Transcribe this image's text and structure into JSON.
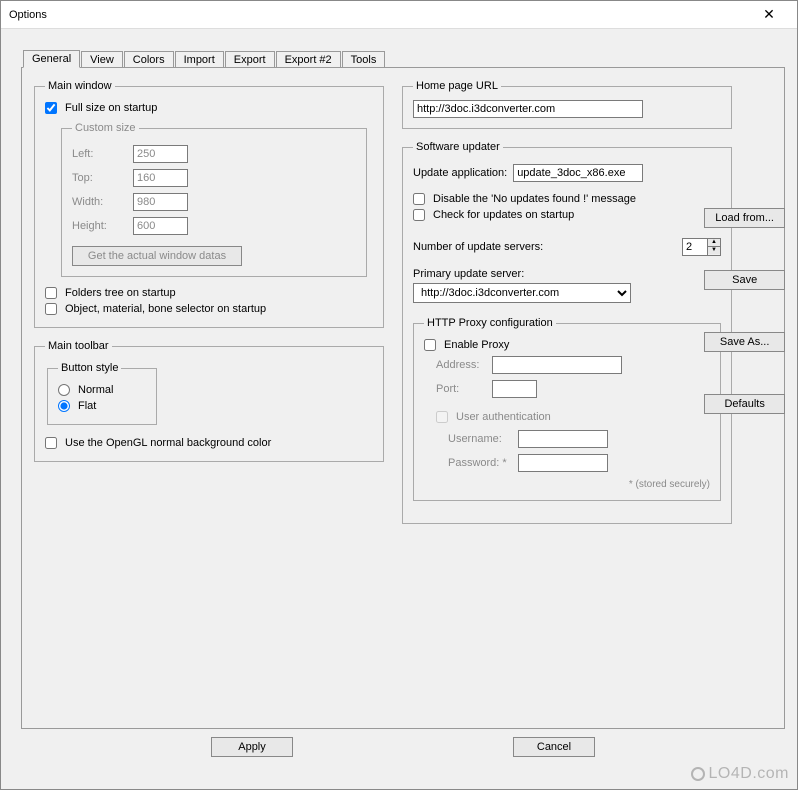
{
  "window": {
    "title": "Options",
    "close": "✕"
  },
  "tabs": [
    "General",
    "View",
    "Colors",
    "Import",
    "Export",
    "Export #2",
    "Tools"
  ],
  "main_window": {
    "legend": "Main window",
    "full_size": "Full size on startup",
    "custom_size": {
      "legend": "Custom size",
      "left_label": "Left:",
      "left": "250",
      "top_label": "Top:",
      "top": "160",
      "width_label": "Width:",
      "width": "980",
      "height_label": "Height:",
      "height": "600",
      "actual_btn": "Get the actual window datas"
    },
    "folders_tree": "Folders tree on startup",
    "obj_selector": "Object, material, bone selector on startup"
  },
  "toolbar": {
    "legend": "Main toolbar",
    "style_legend": "Button style",
    "normal": "Normal",
    "flat": "Flat",
    "opengl_bg": "Use the OpenGL normal background color"
  },
  "home": {
    "legend": "Home page URL",
    "url": "http://3doc.i3dconverter.com"
  },
  "updater": {
    "legend": "Software updater",
    "app_label": "Update application:",
    "app_value": "update_3doc_x86.exe",
    "disable_msg": "Disable the 'No updates found !' message",
    "check_startup": "Check for updates on startup",
    "servers_label": "Number of update servers:",
    "servers_value": "2",
    "primary_label": "Primary update server:",
    "primary_value": "http://3doc.i3dconverter.com"
  },
  "proxy": {
    "legend": "HTTP Proxy configuration",
    "enable": "Enable Proxy",
    "address_label": "Address:",
    "port_label": "Port:",
    "auth": "User authentication",
    "user_label": "Username:",
    "pass_label": "Password: *",
    "note": "* (stored securely)"
  },
  "side": {
    "load": "Load from...",
    "save": "Save",
    "save_as": "Save As...",
    "defaults": "Defaults"
  },
  "bottom": {
    "apply": "Apply",
    "cancel": "Cancel"
  },
  "watermark": "LO4D.com"
}
